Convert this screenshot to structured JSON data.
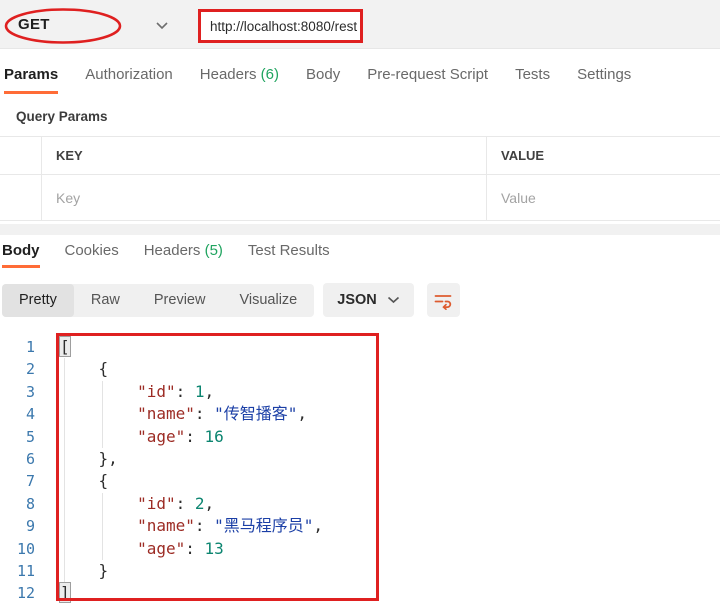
{
  "request": {
    "method": "GET",
    "url": "http://localhost:8080/rest",
    "tabs": [
      {
        "label": "Params"
      },
      {
        "label": "Authorization"
      },
      {
        "label": "Headers",
        "count": "(6)"
      },
      {
        "label": "Body"
      },
      {
        "label": "Pre-request Script"
      },
      {
        "label": "Tests"
      },
      {
        "label": "Settings"
      }
    ],
    "query_params": {
      "title": "Query Params",
      "columns": [
        "KEY",
        "VALUE"
      ],
      "rows": [
        {
          "key_placeholder": "Key",
          "value_placeholder": "Value"
        }
      ]
    }
  },
  "response": {
    "tabs": [
      {
        "label": "Body"
      },
      {
        "label": "Cookies"
      },
      {
        "label": "Headers",
        "count": "(5)"
      },
      {
        "label": "Test Results"
      }
    ],
    "view_modes": [
      "Pretty",
      "Raw",
      "Preview",
      "Visualize"
    ],
    "active_view": "Pretty",
    "format": "JSON",
    "body_json": [
      {
        "id": 1,
        "name": "传智播客",
        "age": 16
      },
      {
        "id": 2,
        "name": "黑马程序员",
        "age": 13
      }
    ],
    "body_lines": [
      {
        "n": "1",
        "tokens": [
          {
            "c": "p",
            "t": "[",
            "m": true
          }
        ]
      },
      {
        "n": "2",
        "tokens": [
          {
            "c": "p",
            "t": "    {"
          }
        ]
      },
      {
        "n": "3",
        "tokens": [
          {
            "c": "k",
            "t": "        \"id\""
          },
          {
            "c": "p",
            "t": ": "
          },
          {
            "c": "n",
            "t": "1"
          },
          {
            "c": "p",
            "t": ","
          }
        ]
      },
      {
        "n": "4",
        "tokens": [
          {
            "c": "k",
            "t": "        \"name\""
          },
          {
            "c": "p",
            "t": ": "
          },
          {
            "c": "s",
            "t": "\"传智播客\""
          },
          {
            "c": "p",
            "t": ","
          }
        ]
      },
      {
        "n": "5",
        "tokens": [
          {
            "c": "k",
            "t": "        \"age\""
          },
          {
            "c": "p",
            "t": ": "
          },
          {
            "c": "n",
            "t": "16"
          }
        ]
      },
      {
        "n": "6",
        "tokens": [
          {
            "c": "p",
            "t": "    },"
          }
        ]
      },
      {
        "n": "7",
        "tokens": [
          {
            "c": "p",
            "t": "    {"
          }
        ]
      },
      {
        "n": "8",
        "tokens": [
          {
            "c": "k",
            "t": "        \"id\""
          },
          {
            "c": "p",
            "t": ": "
          },
          {
            "c": "n",
            "t": "2"
          },
          {
            "c": "p",
            "t": ","
          }
        ]
      },
      {
        "n": "9",
        "tokens": [
          {
            "c": "k",
            "t": "        \"name\""
          },
          {
            "c": "p",
            "t": ": "
          },
          {
            "c": "s",
            "t": "\"黑马程序员\""
          },
          {
            "c": "p",
            "t": ","
          }
        ]
      },
      {
        "n": "10",
        "tokens": [
          {
            "c": "k",
            "t": "        \"age\""
          },
          {
            "c": "p",
            "t": ": "
          },
          {
            "c": "n",
            "t": "13"
          }
        ]
      },
      {
        "n": "11",
        "tokens": [
          {
            "c": "p",
            "t": "    }"
          }
        ]
      },
      {
        "n": "12",
        "tokens": [
          {
            "c": "p",
            "t": "]",
            "m": true
          }
        ]
      }
    ]
  },
  "annotations": {
    "color": "#df2020",
    "items": [
      "ellipse-around-method",
      "rect-around-url",
      "rect-around-response-body"
    ]
  },
  "colors": {
    "accent_orange": "#ff6c37",
    "success_green": "#1fa45f",
    "key_maroon": "#9c2b24",
    "string_navy": "#1b3fa6",
    "number_teal": "#0c8570",
    "line_number_blue": "#3b78ad"
  }
}
